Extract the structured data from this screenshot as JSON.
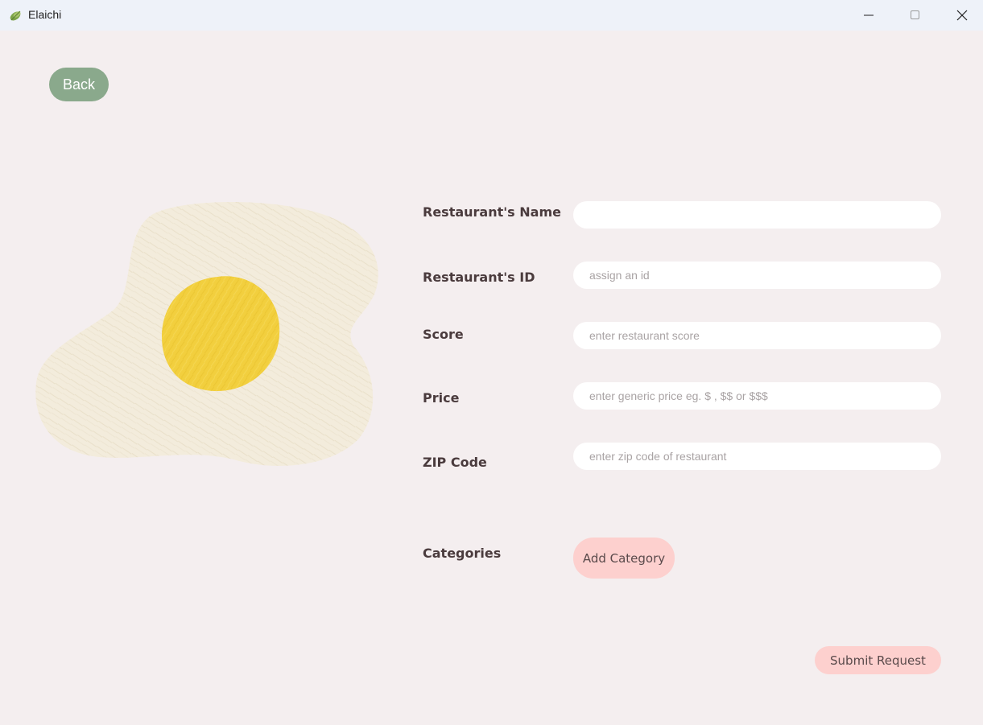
{
  "window": {
    "title": "Elaichi",
    "icon": "cardamom-leaf-icon"
  },
  "nav": {
    "back_label": "Back"
  },
  "form": {
    "fields": [
      {
        "label": "Restaurant's Name",
        "value": "",
        "placeholder": ""
      },
      {
        "label": "Restaurant's ID",
        "value": "",
        "placeholder": "assign an id"
      },
      {
        "label": "Score",
        "value": "",
        "placeholder": "enter restaurant score"
      },
      {
        "label": "Price",
        "value": "",
        "placeholder": "enter generic price eg. $ , $$ or $$$"
      },
      {
        "label": "ZIP Code",
        "value": "",
        "placeholder": "enter zip code of restaurant"
      }
    ],
    "categories_label": "Categories",
    "add_category_label": "Add Category",
    "submit_label": "Submit Request"
  },
  "colors": {
    "background": "#f4eeef",
    "back_button": "#8aa98c",
    "accent_button": "#fdd0ce",
    "egg_white": "#f3ecdc",
    "egg_yolk": "#f2cf3e"
  }
}
